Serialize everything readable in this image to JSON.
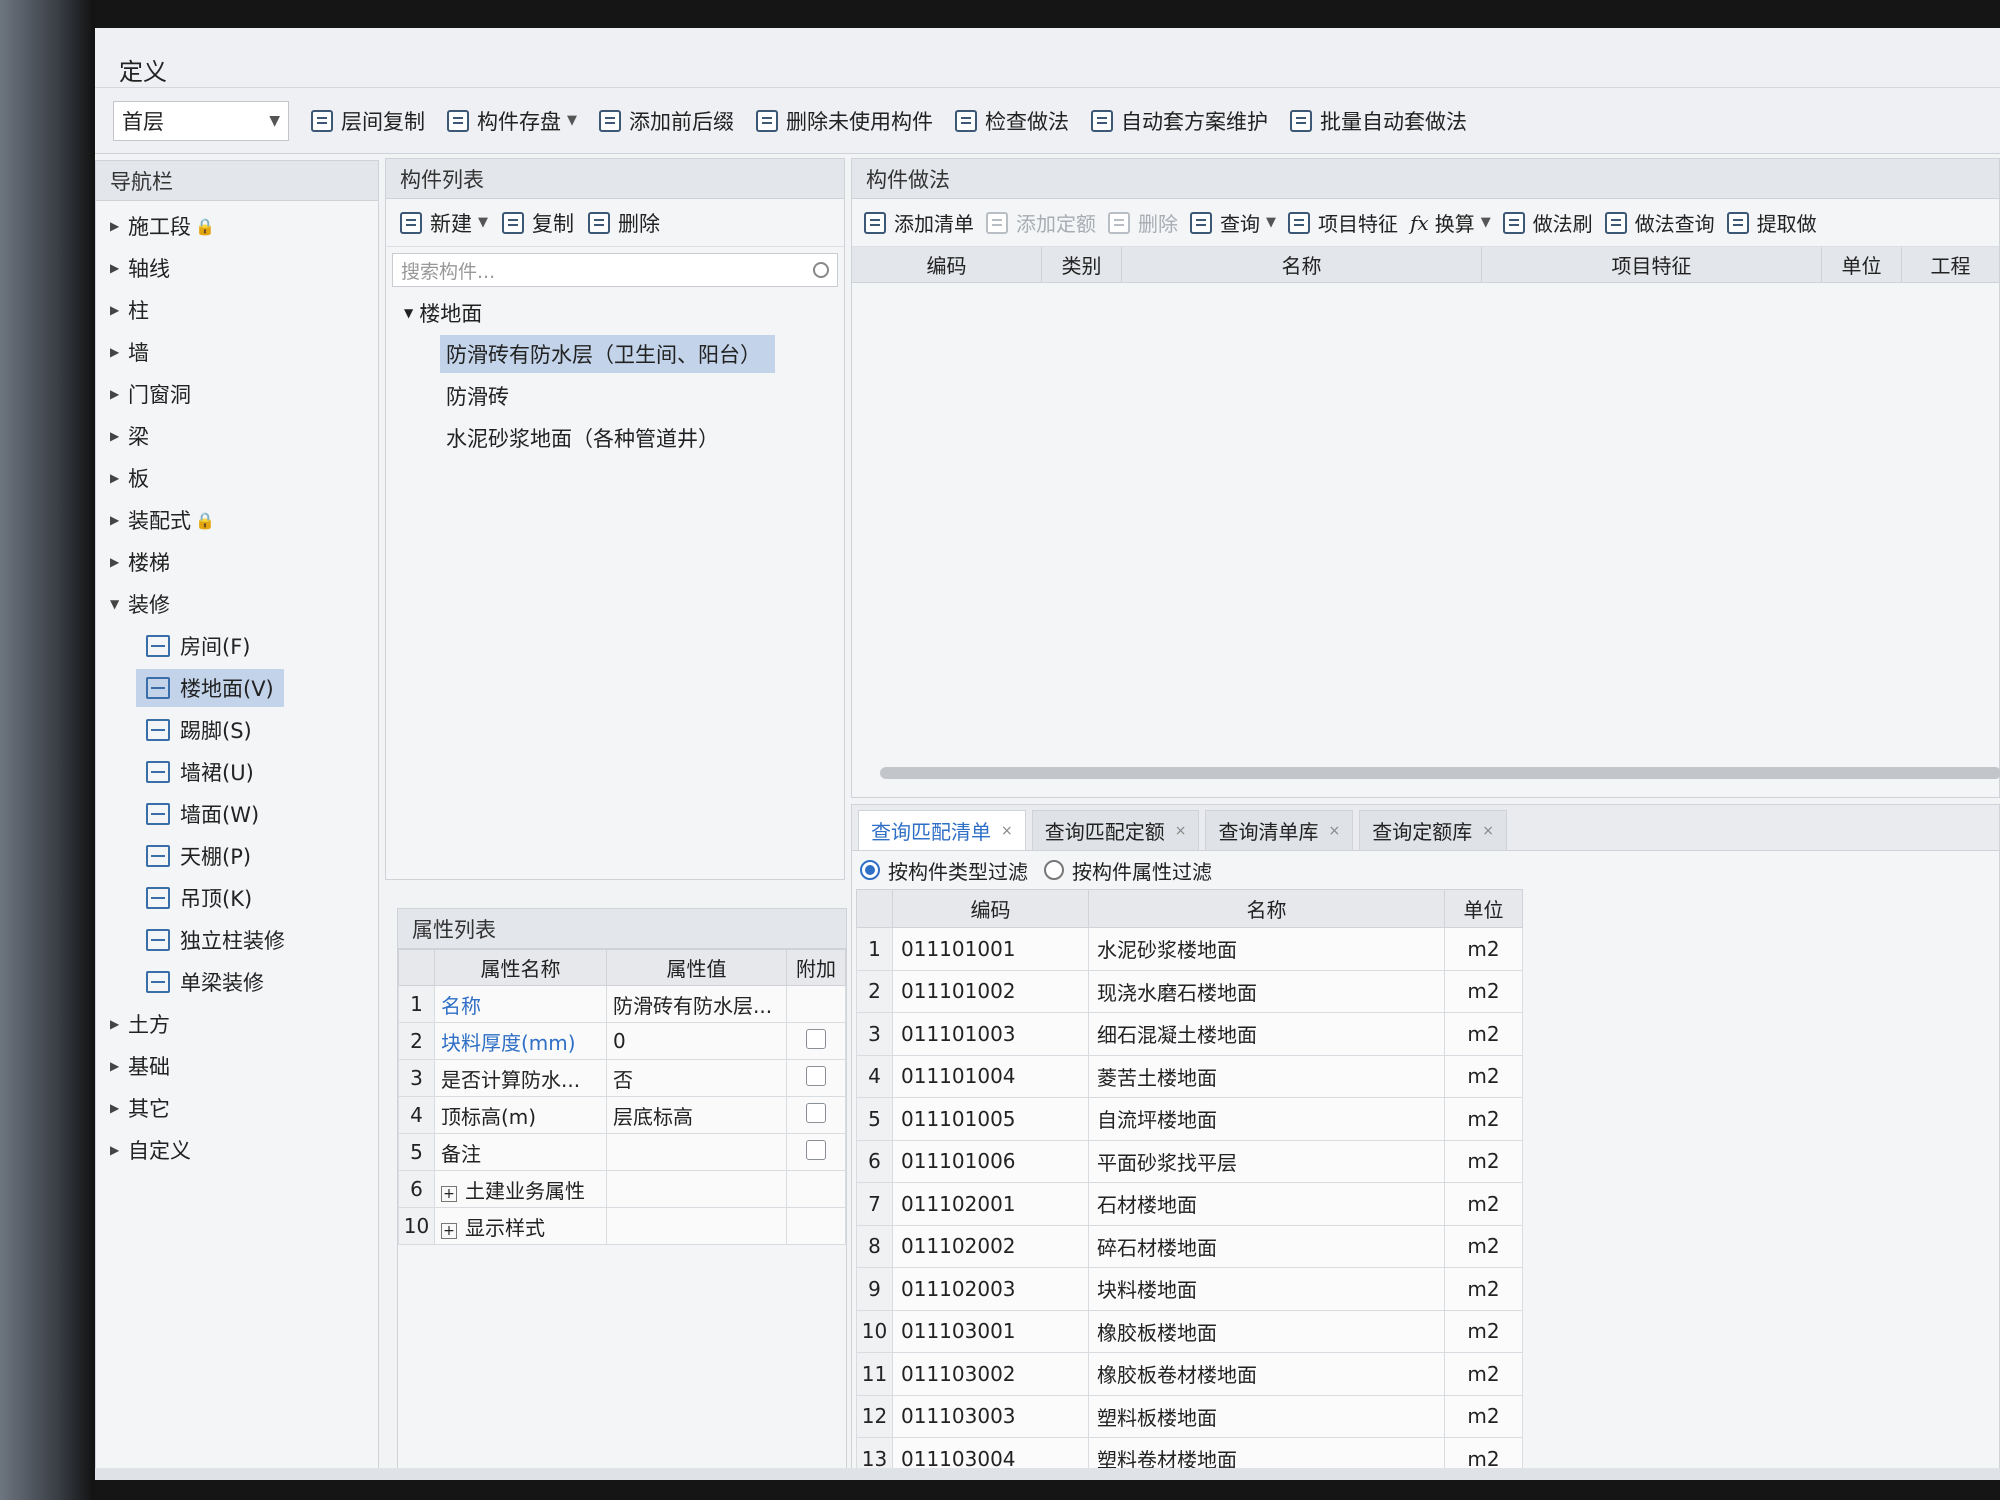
{
  "window": {
    "title": "定义"
  },
  "toolbar": {
    "floor": "首层",
    "items": [
      "层间复制",
      "构件存盘",
      "添加前后缀",
      "删除未使用构件",
      "检查做法",
      "自动套方案维护",
      "批量自动套做法"
    ]
  },
  "nav": {
    "header": "导航栏",
    "items": [
      "施工段",
      "轴线",
      "柱",
      "墙",
      "门窗洞",
      "梁",
      "板",
      "装配式",
      "楼梯",
      "装修"
    ],
    "decoration_children": [
      "房间(F)",
      "楼地面(V)",
      "踢脚(S)",
      "墙裙(U)",
      "墙面(W)",
      "天棚(P)",
      "吊顶(K)",
      "独立柱装修",
      "单梁装修"
    ],
    "selected_child": "楼地面(V)",
    "items_after": [
      "土方",
      "基础",
      "其它",
      "自定义"
    ]
  },
  "component_list": {
    "header": "构件列表",
    "new_label": "新建",
    "copy_label": "复制",
    "delete_label": "删除",
    "search_placeholder": "搜索构件...",
    "root": "楼地面",
    "items": [
      "防滑砖有防水层（卫生间、阳台）",
      "防滑砖",
      "水泥砂浆地面（各种管道井）"
    ],
    "selected_index": 0
  },
  "property_list": {
    "header": "属性列表",
    "columns": [
      "属性名称",
      "属性值",
      "附加"
    ],
    "rows": [
      {
        "num": "1",
        "name": "名称",
        "value": "防滑砖有防水层...",
        "blue": true,
        "checkbox": false
      },
      {
        "num": "2",
        "name": "块料厚度(mm)",
        "value": "0",
        "blue": true,
        "checkbox": true
      },
      {
        "num": "3",
        "name": "是否计算防水...",
        "value": "否",
        "blue": false,
        "checkbox": true
      },
      {
        "num": "4",
        "name": "顶标高(m)",
        "value": "层底标高",
        "blue": false,
        "checkbox": true
      },
      {
        "num": "5",
        "name": "备注",
        "value": "",
        "blue": false,
        "checkbox": true
      },
      {
        "num": "6",
        "name": "土建业务属性",
        "value": "",
        "blue": false,
        "checkbox": false,
        "expand": true
      },
      {
        "num": "10",
        "name": "显示样式",
        "value": "",
        "blue": false,
        "checkbox": false,
        "expand": true
      }
    ]
  },
  "construction_method": {
    "header": "构件做法",
    "toolbar": [
      "添加清单",
      "添加定额",
      "删除",
      "查询",
      "项目特征",
      "换算",
      "做法刷",
      "做法查询",
      "提取做"
    ],
    "disabled": [
      "添加定额",
      "删除"
    ],
    "columns": [
      "编码",
      "类别",
      "名称",
      "项目特征",
      "单位",
      "工程"
    ]
  },
  "query": {
    "tabs": [
      "查询匹配清单",
      "查询匹配定额",
      "查询清单库",
      "查询定额库"
    ],
    "active_tab": 0,
    "filters": [
      "按构件类型过滤",
      "按构件属性过滤"
    ],
    "active_filter": 0,
    "columns": [
      "编码",
      "名称",
      "单位"
    ],
    "rows": [
      [
        "1",
        "011101001",
        "水泥砂浆楼地面",
        "m2"
      ],
      [
        "2",
        "011101002",
        "现浇水磨石楼地面",
        "m2"
      ],
      [
        "3",
        "011101003",
        "细石混凝土楼地面",
        "m2"
      ],
      [
        "4",
        "011101004",
        "菱苦土楼地面",
        "m2"
      ],
      [
        "5",
        "011101005",
        "自流坪楼地面",
        "m2"
      ],
      [
        "6",
        "011101006",
        "平面砂浆找平层",
        "m2"
      ],
      [
        "7",
        "011102001",
        "石材楼地面",
        "m2"
      ],
      [
        "8",
        "011102002",
        "碎石材楼地面",
        "m2"
      ],
      [
        "9",
        "011102003",
        "块料楼地面",
        "m2"
      ],
      [
        "10",
        "011103001",
        "橡胶板楼地面",
        "m2"
      ],
      [
        "11",
        "011103002",
        "橡胶板卷材楼地面",
        "m2"
      ],
      [
        "12",
        "011103003",
        "塑料板楼地面",
        "m2"
      ],
      [
        "13",
        "011103004",
        "塑料卷材楼地面",
        "m2"
      ]
    ]
  }
}
